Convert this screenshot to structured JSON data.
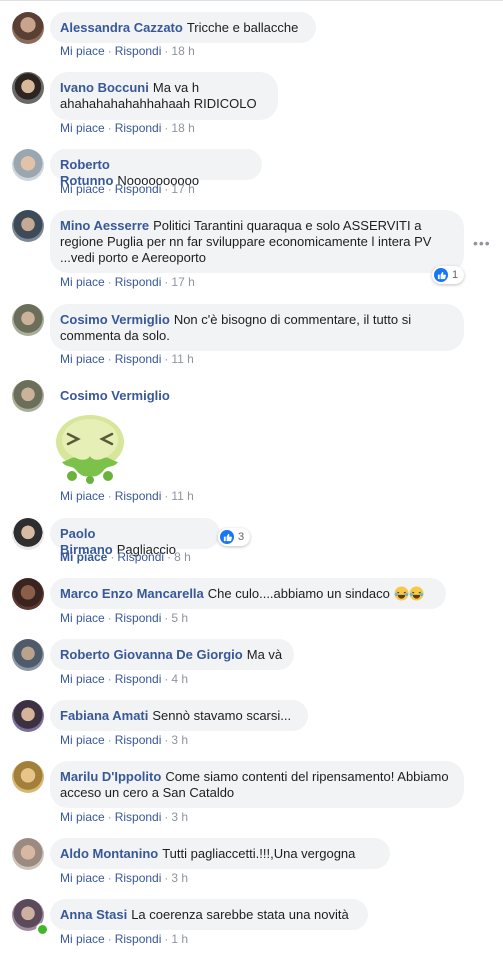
{
  "labels": {
    "like": "Mi piace",
    "reply": "Rispondi",
    "sep": "·"
  },
  "comments": [
    {
      "author": "Alessandra Cazzato",
      "text": "Tricche e ballacche",
      "time": "18 h"
    },
    {
      "author": "Ivano Boccuni",
      "text": "Ma va h ahahahahahahhahaah RIDICOLO",
      "time": "18 h"
    },
    {
      "author": "Roberto Rotunno",
      "text": "Noooooooooo",
      "time": "17 h"
    },
    {
      "author": "Mino Aesserre",
      "text": "Politici Tarantini quaraqua e solo ASSERVITI a regione Puglia per nn far sviluppare economicamente l intera PV ...vedi porto e Aereoporto",
      "time": "17 h",
      "reactions": "1"
    },
    {
      "author": "Cosimo Vermiglio",
      "text": "Non c'è bisogno di commentare, il tutto si commenta da solo.",
      "time": "11 h"
    },
    {
      "author": "Cosimo Vermiglio",
      "text": "",
      "time": "11 h",
      "sticker": "nauseated-sticker"
    },
    {
      "author": "Paolo Birmano",
      "text": "Pagliaccio",
      "time": "8 h",
      "reactions": "3",
      "liked": true
    },
    {
      "author": "Marco Enzo Mancarella",
      "text": "Che culo....abbiamo un sindaco",
      "time": "5 h",
      "emoji": "laughing-tears-emoji"
    },
    {
      "author": "Roberto Giovanna De Giorgio",
      "text": "Ma và",
      "time": "4 h"
    },
    {
      "author": "Fabiana Amati",
      "text": "Sennò stavamo scarsi...",
      "time": "3 h"
    },
    {
      "author": "Marilu D'Ippolito",
      "text": "Come siamo contenti del ripensamento! Abbiamo acceso un cero a San Cataldo",
      "time": "3 h"
    },
    {
      "author": "Aldo Montanino",
      "text": "Tutti pagliaccetti.!!!,Una vergogna",
      "time": "3 h"
    },
    {
      "author": "Anna Stasi",
      "text": "La coerenza sarebbe stata una novità",
      "time": "1 h",
      "online": true
    }
  ],
  "colors": {
    "link": "#385898",
    "bubble": "#f2f3f5",
    "meta": "#90949c",
    "like_blue": "#1877f2",
    "online": "#42b72a"
  }
}
